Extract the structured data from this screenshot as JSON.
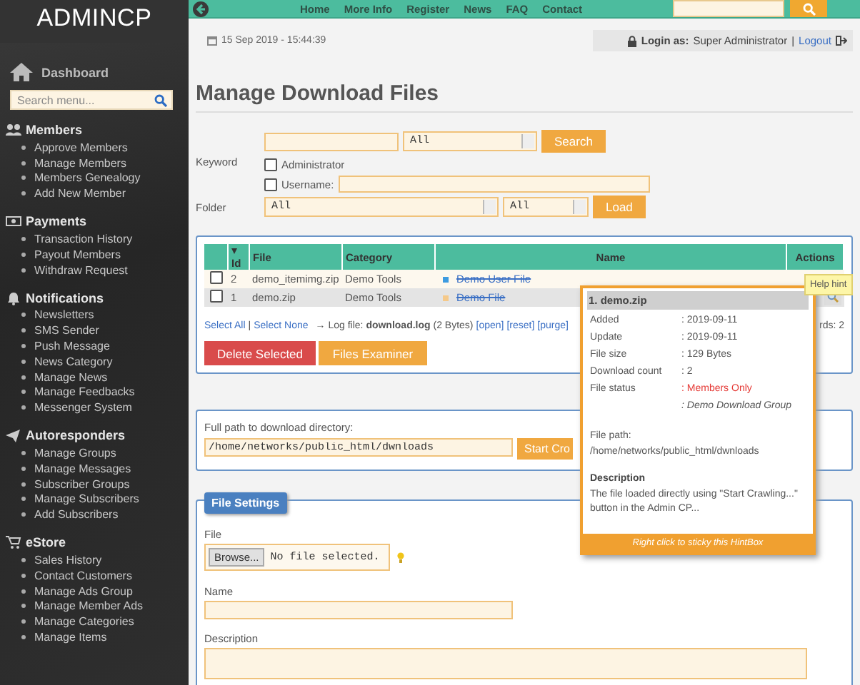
{
  "sidebar": {
    "title": "ADMINCP",
    "dashboard": "Dashboard",
    "search": {
      "placeholder": "Search menu..."
    },
    "sections": [
      {
        "kind": "members",
        "title": "Members",
        "items": [
          "Approve Members",
          "Manage Members",
          "Members Genealogy",
          "Add New Member"
        ]
      },
      {
        "kind": "payments",
        "title": "Payments",
        "items": [
          "Transaction History",
          "Payout Members",
          "Withdraw Request"
        ]
      },
      {
        "kind": "notifications",
        "title": "Notifications",
        "items": [
          "Newsletters",
          "SMS Sender",
          "Push Message",
          "News Category",
          "Manage News",
          "Manage Feedbacks",
          "Messenger System"
        ]
      },
      {
        "kind": "autoresponders",
        "title": "Autoresponders",
        "items": [
          "Manage Groups",
          "Manage Messages",
          "Subscriber Groups",
          "Manage Subscribers",
          "Add Subscribers"
        ]
      },
      {
        "kind": "estore",
        "title": "eStore",
        "items": [
          "Sales History",
          "Contact Customers",
          "Manage Ads Group",
          "Manage Member Ads",
          "Manage Categories",
          "Manage Items"
        ]
      }
    ]
  },
  "topbar": {
    "nav": [
      "Home",
      "More Info",
      "Register",
      "News",
      "FAQ",
      "Contact"
    ]
  },
  "date": "15 Sep 2019 - 15:44:39",
  "login": {
    "label": "Login as:",
    "user": "Super Administrator",
    "separator": "|",
    "logout": "Logout"
  },
  "page_title": "Manage Download Files",
  "filters": {
    "keyword_label": "Keyword",
    "category_select": "All",
    "search_button": "Search",
    "checkboxes": [
      {
        "label": "Administrator",
        "checked": false
      },
      {
        "label": "Username:",
        "checked": false
      }
    ],
    "folder_label": "Folder",
    "folder_select": "All",
    "subfolder_select": "All",
    "load_button": "Load"
  },
  "table": {
    "columns": [
      "Id",
      "File",
      "Category",
      "Name",
      "Actions"
    ],
    "rows": [
      {
        "selected": false,
        "id": "2",
        "file": "demo_itemimg.zip",
        "category": "Demo Tools",
        "name": "Demo User File",
        "color": "#3d9be0"
      },
      {
        "selected": false,
        "id": "1",
        "file": "demo.zip",
        "category": "Demo Tools",
        "name": "Demo File",
        "color": "#f5c98a"
      }
    ]
  },
  "table_footer": {
    "select_all": "Select All",
    "separator": "|",
    "select_none": "Select None",
    "log": "→ Log file: **download.log** (2 Bytes)",
    "log_links": [
      "[open]",
      "[reset]",
      "[purge]"
    ],
    "records": "rds: 2"
  },
  "actions": [
    "Delete Selected",
    "Files Examiner"
  ],
  "path": {
    "label": "Full path to download directory:",
    "value": "/home/networks/public_html/dwnloads",
    "button": "Start Cro"
  },
  "file_settings": {
    "legend": "File Settings",
    "file_label": "File",
    "browse": "Browse...",
    "no_file": "No file selected.",
    "name_label": "Name",
    "description_label": "Description"
  },
  "hintbox": {
    "title": "1. demo.zip",
    "rows": [
      {
        "kind": "plain",
        "label": "Added",
        "value": ": 2019-09-11"
      },
      {
        "kind": "plain",
        "label": "Update",
        "value": ": 2019-09-11"
      },
      {
        "kind": "plain",
        "label": "File size",
        "value": ": 129 Bytes"
      },
      {
        "kind": "plain",
        "label": "Download count",
        "value": ": 2"
      },
      {
        "kind": "alert",
        "label": "File status",
        "value": ": Members Only"
      },
      {
        "kind": "note",
        "value": ": Demo Download Group"
      }
    ],
    "path_label": "File path:",
    "path": "/home/networks/public_html/dwnloads",
    "description_title": "Description",
    "description": "The file loaded directly using \"Start Crawling...\" button in the Admin CP...",
    "footer": "Right click to sticky this HintBox"
  },
  "tooltip": "Help hint"
}
